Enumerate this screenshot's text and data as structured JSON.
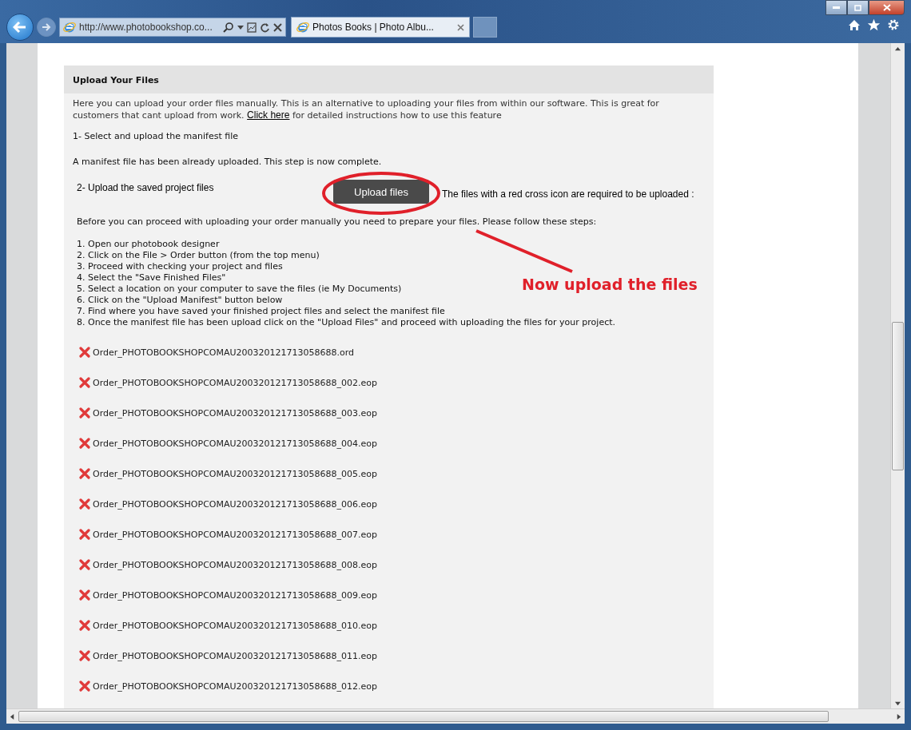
{
  "browser": {
    "address": "http://www.photobookshop.co...",
    "tab_title": "Photos Books | Photo Albu..."
  },
  "panel": {
    "title": "Upload Your Files",
    "intro_before": "Here you can upload your order files manually. This is an alternative to uploading your files from within our software. This is great for customers that cant upload from work. ",
    "intro_link": "Click here",
    "intro_after": " for detailed instructions how to use this feature",
    "step1_title": "1- Select and upload the manifest file",
    "step1_status": "A manifest file has been already uploaded. This step is now complete.",
    "step2_title": "2- Upload the saved project files",
    "upload_button": "Upload files",
    "step2_note": "The files with a red cross icon are required to be uploaded :",
    "instructions_intro": "Before you can proceed with uploading your order manually you need to prepare your files. Please follow these steps:",
    "steps": [
      "1. Open our photobook designer",
      "2. Click on the File > Order button (from the top menu)",
      "3. Proceed with checking your project and files",
      "4. Select the \"Save Finished Files\"",
      "5. Select a location on your computer to save the files (ie My Documents)",
      "6. Click on the \"Upload Manifest\" button below",
      "7. Find where you have saved your finished project files and select the manifest file",
      "8. Once the manifest file has been upload click on the \"Upload Files\" and proceed with uploading the files for your project."
    ],
    "files": [
      {
        "name": "Order_PHOTOBOOKSHOPCOMAU200320121713058688.ord",
        "uploaded": false
      },
      {
        "name": "Order_PHOTOBOOKSHOPCOMAU200320121713058688_002.eop",
        "uploaded": false
      },
      {
        "name": "Order_PHOTOBOOKSHOPCOMAU200320121713058688_003.eop",
        "uploaded": false
      },
      {
        "name": "Order_PHOTOBOOKSHOPCOMAU200320121713058688_004.eop",
        "uploaded": false
      },
      {
        "name": "Order_PHOTOBOOKSHOPCOMAU200320121713058688_005.eop",
        "uploaded": false
      },
      {
        "name": "Order_PHOTOBOOKSHOPCOMAU200320121713058688_006.eop",
        "uploaded": false
      },
      {
        "name": "Order_PHOTOBOOKSHOPCOMAU200320121713058688_007.eop",
        "uploaded": false
      },
      {
        "name": "Order_PHOTOBOOKSHOPCOMAU200320121713058688_008.eop",
        "uploaded": false
      },
      {
        "name": "Order_PHOTOBOOKSHOPCOMAU200320121713058688_009.eop",
        "uploaded": false
      },
      {
        "name": "Order_PHOTOBOOKSHOPCOMAU200320121713058688_010.eop",
        "uploaded": false
      },
      {
        "name": "Order_PHOTOBOOKSHOPCOMAU200320121713058688_011.eop",
        "uploaded": false
      },
      {
        "name": "Order_PHOTOBOOKSHOPCOMAU200320121713058688_012.eop",
        "uploaded": false
      }
    ]
  },
  "annotation": {
    "text": "Now upload the files"
  }
}
